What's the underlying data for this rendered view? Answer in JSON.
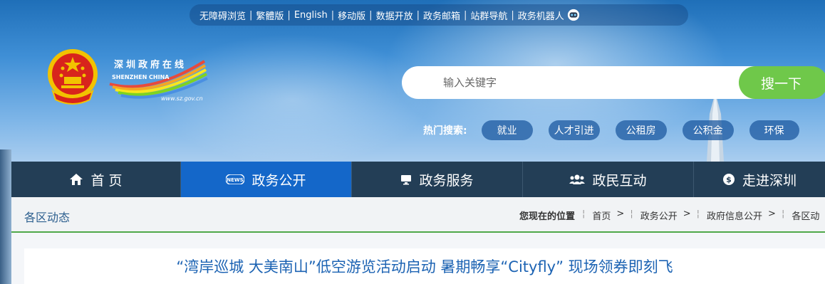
{
  "topbar": {
    "links": [
      "无障碍浏览",
      "繁體版",
      "English",
      "移动版",
      "数据开放",
      "政务邮箱",
      "站群导航",
      "政务机器人"
    ],
    "robot_icon": "robot-icon"
  },
  "logo": {
    "name_cn": "深圳政府在线",
    "name_en": "SHENZHEN CHINA",
    "url": "www.sz.gov.cn"
  },
  "search": {
    "placeholder": "输入关键字",
    "button_label": "搜一下"
  },
  "hot_search": {
    "label": "热门搜索:",
    "tags": [
      "就业",
      "人才引进",
      "公租房",
      "公积金",
      "环保"
    ]
  },
  "nav": {
    "items": [
      {
        "label": "首 页",
        "icon": "home-icon",
        "active": false
      },
      {
        "label": "政务公开",
        "icon": "news-icon",
        "active": true
      },
      {
        "label": "政务服务",
        "icon": "monitor-icon",
        "active": false
      },
      {
        "label": "政民互动",
        "icon": "people-icon",
        "active": false
      },
      {
        "label": "走进深圳",
        "icon": "info-icon",
        "active": false
      }
    ]
  },
  "breadcrumb": {
    "section_title": "各区动态",
    "current_label": "您现在的位置",
    "items": [
      "首页",
      "政务公开",
      "政府信息公开",
      "各区动"
    ]
  },
  "article": {
    "title": "“湾岸巡城 大美南山”低空游览活动启动 暑期畅享“Cityfly” 现场领券即刻飞"
  },
  "colors": {
    "nav_bg": "#233e56",
    "nav_active": "#1467c9",
    "search_button": "#6fc84a",
    "headline": "#1c63b3",
    "divider_green": "#4fa84a"
  }
}
